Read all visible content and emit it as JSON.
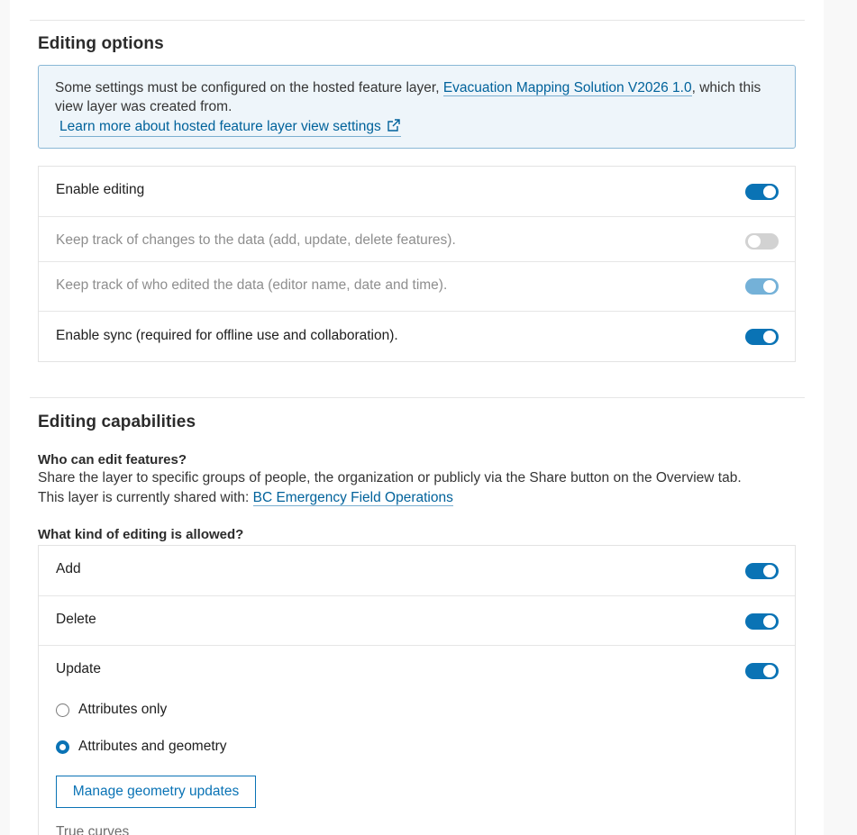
{
  "editing_options": {
    "title": "Editing options",
    "notice": {
      "text_before": "Some settings must be configured on the hosted feature layer, ",
      "layer_link": "Evacuation Mapping Solution V2026 1.0",
      "text_after": ", which this view layer was created from.",
      "learn_more": "Learn more about hosted feature layer view settings",
      "learn_more_icon": "external-link-icon"
    },
    "settings": [
      {
        "label": "Enable editing",
        "enabled": true,
        "disabled": false
      },
      {
        "label": "Keep track of changes to the data (add, update, delete features).",
        "enabled": false,
        "disabled": true
      },
      {
        "label": "Keep track of who edited the data (editor name, date and time).",
        "enabled": true,
        "disabled": true
      },
      {
        "label": "Enable sync (required for offline use and collaboration).",
        "enabled": true,
        "disabled": false
      }
    ]
  },
  "editing_capabilities": {
    "title": "Editing capabilities",
    "who_heading": "Who can edit features?",
    "who_text": "Share the layer to specific groups of people, the organization or publicly via the Share button on the Overview tab.",
    "shared_with_prefix": "This layer is currently shared with: ",
    "shared_with_link": "BC Emergency Field Operations",
    "kind_heading": "What kind of editing is allowed?",
    "operations": [
      {
        "label": "Add",
        "enabled": true
      },
      {
        "label": "Delete",
        "enabled": true
      },
      {
        "label": "Update",
        "enabled": true
      }
    ],
    "update_options": [
      {
        "label": "Attributes only",
        "selected": false
      },
      {
        "label": "Attributes and geometry",
        "selected": true
      }
    ],
    "manage_button": "Manage geometry updates",
    "true_curves_label": "True curves"
  },
  "colors": {
    "accent": "#0a73b5",
    "link": "#00629b",
    "notice_bg": "#eef5fa",
    "notice_border": "#89b7d6"
  }
}
